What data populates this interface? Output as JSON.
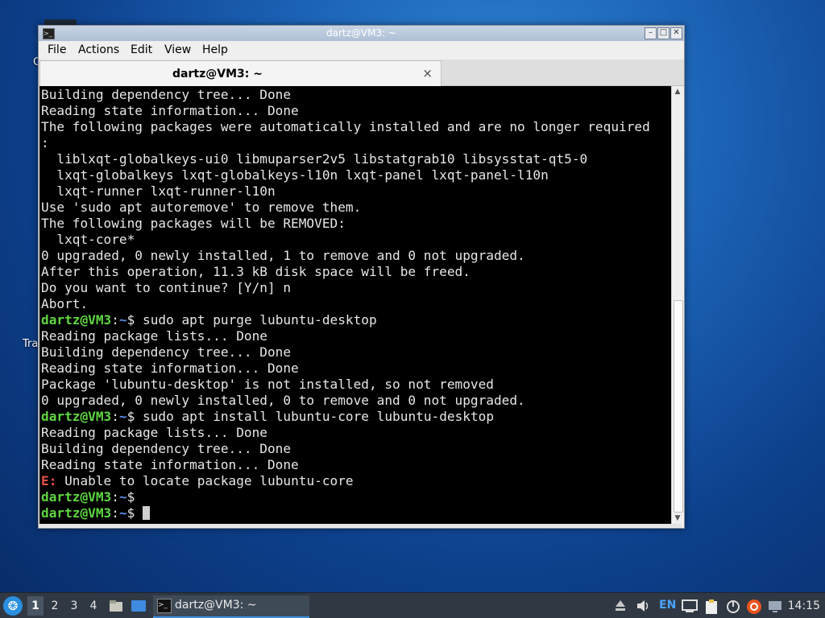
{
  "desktop": {
    "fragment_1": "C",
    "fragment_2": "Tra"
  },
  "window": {
    "title": "dartz@VM3: ~",
    "menu": [
      "File",
      "Actions",
      "Edit",
      "View",
      "Help"
    ],
    "tab_label": "dartz@VM3: ~",
    "tab_close": "×"
  },
  "prompt": {
    "user_host": "dartz@VM3",
    "colon": ":",
    "path": "~",
    "dollar": "$"
  },
  "terminal_lines": [
    {
      "kind": "text",
      "text": "Building dependency tree... Done"
    },
    {
      "kind": "text",
      "text": "Reading state information... Done"
    },
    {
      "kind": "text",
      "text": "The following packages were automatically installed and are no longer required"
    },
    {
      "kind": "text",
      "text": ":"
    },
    {
      "kind": "text",
      "text": "  liblxqt-globalkeys-ui0 libmuparser2v5 libstatgrab10 libsysstat-qt5-0"
    },
    {
      "kind": "text",
      "text": "  lxqt-globalkeys lxqt-globalkeys-l10n lxqt-panel lxqt-panel-l10n"
    },
    {
      "kind": "text",
      "text": "  lxqt-runner lxqt-runner-l10n"
    },
    {
      "kind": "text",
      "text": "Use 'sudo apt autoremove' to remove them."
    },
    {
      "kind": "text",
      "text": "The following packages will be REMOVED:"
    },
    {
      "kind": "text",
      "text": "  lxqt-core*"
    },
    {
      "kind": "text",
      "text": "0 upgraded, 0 newly installed, 1 to remove and 0 not upgraded."
    },
    {
      "kind": "text",
      "text": "After this operation, 11.3 kB disk space will be freed."
    },
    {
      "kind": "text",
      "text": "Do you want to continue? [Y/n] n"
    },
    {
      "kind": "text",
      "text": "Abort."
    },
    {
      "kind": "cmd",
      "text": " sudo apt purge lubuntu-desktop"
    },
    {
      "kind": "text",
      "text": "Reading package lists... Done"
    },
    {
      "kind": "text",
      "text": "Building dependency tree... Done"
    },
    {
      "kind": "text",
      "text": "Reading state information... Done"
    },
    {
      "kind": "text",
      "text": "Package 'lubuntu-desktop' is not installed, so not removed"
    },
    {
      "kind": "text",
      "text": "0 upgraded, 0 newly installed, 0 to remove and 0 not upgraded."
    },
    {
      "kind": "cmd",
      "text": " sudo apt install lubuntu-core lubuntu-desktop"
    },
    {
      "kind": "text",
      "text": "Reading package lists... Done"
    },
    {
      "kind": "text",
      "text": "Building dependency tree... Done"
    },
    {
      "kind": "text",
      "text": "Reading state information... Done"
    },
    {
      "kind": "error",
      "prefix": "E:",
      "text": " Unable to locate package lubuntu-core"
    },
    {
      "kind": "cmd",
      "text": ""
    },
    {
      "kind": "cmd",
      "text": " ",
      "cursor": true
    }
  ],
  "taskbar": {
    "workspaces": [
      "1",
      "2",
      "3",
      "4"
    ],
    "active_workspace": "1",
    "task_label": "dartz@VM3: ~",
    "keyboard_layout": "EN",
    "clock": "14:15"
  },
  "colors": {
    "prompt_green": "#5ed641",
    "path_blue": "#5c8be6",
    "error_red": "#e8524a",
    "terminal_bg": "#000000",
    "taskbar_bg": "#303843"
  }
}
